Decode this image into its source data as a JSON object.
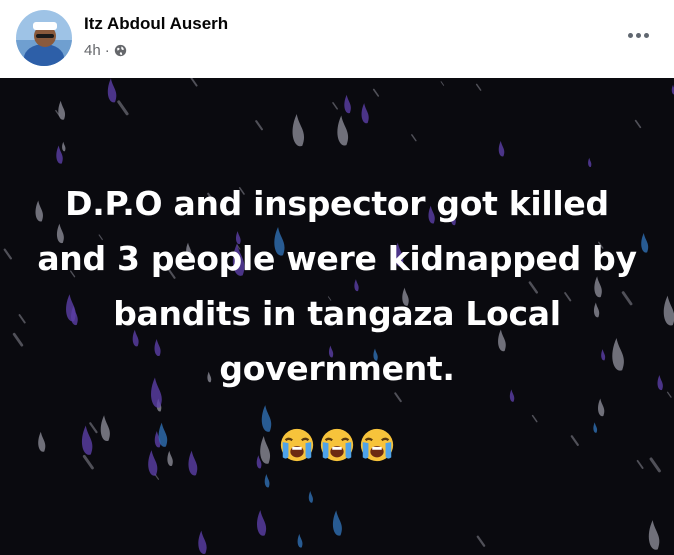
{
  "post": {
    "author": "Itz Abdoul Auserh",
    "time": "4h",
    "separator": "·",
    "privacy_icon": "globe-icon",
    "more_icon": "more-options-icon",
    "text": "D.P.O and inspector got killed and 3 people were kidnapped by bandits in tangaza Local government.",
    "emojis": [
      "loudly-crying-face-icon",
      "loudly-crying-face-icon",
      "loudly-crying-face-icon"
    ]
  },
  "colors": {
    "background": "#0a0a0f",
    "drop_purple": "#5b3fa6",
    "drop_blue": "#2f6fb3",
    "drop_gray": "#8a8a95",
    "text": "#ffffff",
    "name": "#050505",
    "meta": "#65676b"
  }
}
